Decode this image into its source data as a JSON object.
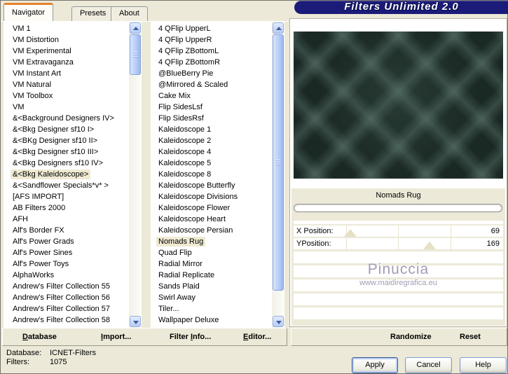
{
  "window": {
    "title": "Filters Unlimited 2.0"
  },
  "tabs": [
    {
      "label": "Navigator",
      "active": true
    },
    {
      "label": "Presets",
      "active": false
    },
    {
      "label": "About",
      "active": false
    }
  ],
  "category_list": {
    "selected": "&<Bkg Kaleidoscope>",
    "items": [
      "VM 1",
      "VM Distortion",
      "VM Experimental",
      "VM Extravaganza",
      "VM Instant Art",
      "VM Natural",
      "VM Toolbox",
      "VM",
      "&<Background Designers IV>",
      "&<Bkg Designer sf10 I>",
      "&<BKg Designer sf10 II>",
      "&<Bkg Designer sf10 III>",
      "&<Bkg Designers sf10 IV>",
      "&<Bkg Kaleidoscope>",
      "&<Sandflower Specials*v* >",
      "[AFS IMPORT]",
      "AB Filters 2000",
      "AFH",
      "Alf's Border FX",
      "Alf's Power Grads",
      "Alf's Power Sines",
      "Alf's Power Toys",
      "AlphaWorks",
      "Andrew's Filter Collection 55",
      "Andrew's Filter Collection 56",
      "Andrew's Filter Collection 57",
      "Andrew's Filter Collection 58"
    ]
  },
  "filter_list": {
    "selected": "Nomads Rug",
    "items": [
      "4 QFlip UpperL",
      "4 QFlip UpperR",
      "4 QFlip ZBottomL",
      "4 QFlip ZBottomR",
      "@BlueBerry Pie",
      "@Mirrored & Scaled",
      "Cake Mix",
      "Flip SidesLsf",
      "Flip SidesRsf",
      "Kaleidoscope 1",
      "Kaleidoscope 2",
      "Kaleidoscope 4",
      "Kaleidoscope 5",
      "Kaleidoscope 8",
      "Kaleidoscope Butterfly",
      "Kaleidoscope Divisions",
      "Kaleidoscope Flower",
      "Kaleidoscope Heart",
      "Kaleidoscope Persian",
      "Nomads Rug",
      "Quad Flip",
      "Radial Mirror",
      "Radial Replicate",
      "Sands Plaid",
      "Swirl Away",
      "Tiler...",
      "Wallpaper Deluxe"
    ]
  },
  "preview": {
    "caption": "Nomads Rug"
  },
  "params": [
    {
      "label": "X Position:",
      "value": "69",
      "slider_percent": 27
    },
    {
      "label": "YPosition:",
      "value": "169",
      "slider_percent": 65
    }
  ],
  "watermark": {
    "name": "Pinuccia",
    "url": "www.maidiregrafica.eu"
  },
  "toolbar_left": [
    {
      "pre": "",
      "key": "D",
      "post": "atabase"
    },
    {
      "pre": "",
      "key": "I",
      "post": "mport..."
    },
    {
      "pre": "Filter ",
      "key": "I",
      "post": "nfo..."
    },
    {
      "pre": "",
      "key": "E",
      "post": "ditor..."
    }
  ],
  "toolbar_right": [
    {
      "label": "Randomize"
    },
    {
      "label": "Reset"
    }
  ],
  "status": [
    {
      "label": "Database:",
      "value": "ICNET-Filters"
    },
    {
      "label": "Filters:",
      "value": "1075"
    }
  ],
  "buttons": [
    {
      "label": "Apply"
    },
    {
      "label": "Cancel"
    },
    {
      "label": "Help"
    }
  ],
  "colors": {
    "banner_navy": "#1b1b7a",
    "tab_accent_orange": "#e5822d",
    "selection_beige": "#efead2",
    "dialog_beige": "#ece9d8",
    "preview_teal": "#1b2925",
    "watermark_gray": "#a39bb4"
  }
}
